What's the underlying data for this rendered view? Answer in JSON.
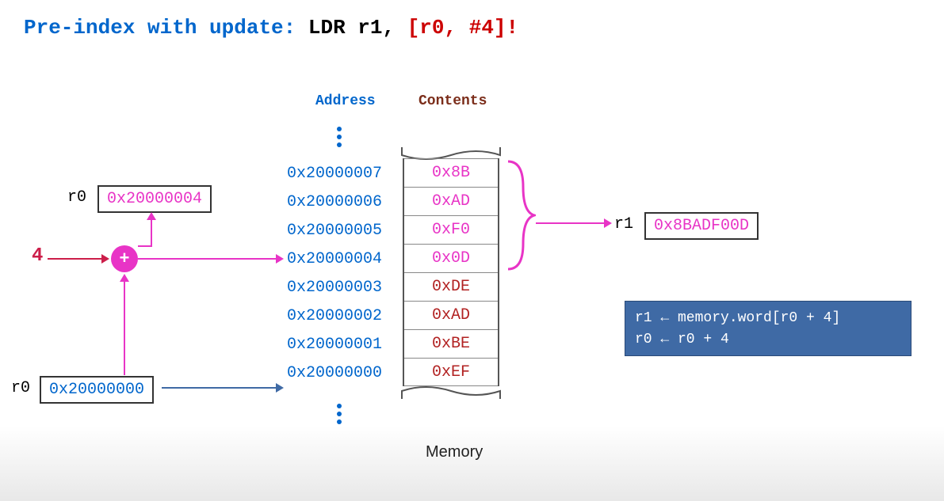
{
  "title": {
    "prefix": "Pre-index with update:",
    "mnem": "LDR r1, ",
    "operand": "[r0, #4]!"
  },
  "headers": {
    "address": "Address",
    "contents": "Contents"
  },
  "memory_caption": "Memory",
  "registers": {
    "r0_updated": {
      "name": "r0",
      "value": "0x20000004"
    },
    "r0_initial": {
      "name": "r0",
      "value": "0x20000000"
    },
    "r1": {
      "name": "r1",
      "value": "0x8BADF00D"
    }
  },
  "offset": "4",
  "adder": "+",
  "memory": [
    {
      "addr": "0x20000007",
      "val": "0x8B",
      "hl": true
    },
    {
      "addr": "0x20000006",
      "val": "0xAD",
      "hl": true
    },
    {
      "addr": "0x20000005",
      "val": "0xF0",
      "hl": true
    },
    {
      "addr": "0x20000004",
      "val": "0x0D",
      "hl": true
    },
    {
      "addr": "0x20000003",
      "val": "0xDE",
      "hl": false
    },
    {
      "addr": "0x20000002",
      "val": "0xAD",
      "hl": false
    },
    {
      "addr": "0x20000001",
      "val": "0xBE",
      "hl": false
    },
    {
      "addr": "0x20000000",
      "val": "0xEF",
      "hl": false
    }
  ],
  "pseudocode": {
    "line1": "r1 ← memory.word[r0 + 4]",
    "line2": "r0 ← r0 + 4"
  }
}
